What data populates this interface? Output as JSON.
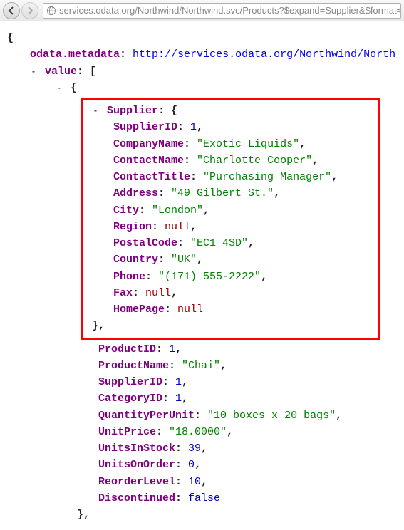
{
  "browser": {
    "url": "services.odata.org/Northwind/Northwind.svc/Products?$expand=Supplier&$format=jso"
  },
  "json": {
    "metadata_key": "odata.metadata",
    "metadata_url": "http://services.odata.org/Northwind/North",
    "value_key": "value",
    "supplier_key": "Supplier",
    "supplier": {
      "SupplierID": "1",
      "CompanyName": "\"Exotic Liquids\"",
      "ContactName": "\"Charlotte Cooper\"",
      "ContactTitle": "\"Purchasing Manager\"",
      "Address": "\"49 Gilbert St.\"",
      "City": "\"London\"",
      "Region": "null",
      "PostalCode": "\"EC1 4SD\"",
      "Country": "\"UK\"",
      "Phone": "\"(171) 555-2222\"",
      "Fax": "null",
      "HomePage": "null"
    },
    "product": {
      "ProductID": "1",
      "ProductName": "\"Chai\"",
      "SupplierID": "1",
      "CategoryID": "1",
      "QuantityPerUnit": "\"10 boxes x 20 bags\"",
      "UnitPrice": "\"18.0000\"",
      "UnitsInStock": "39",
      "UnitsOnOrder": "0",
      "ReorderLevel": "10",
      "Discontinued": "false"
    },
    "keys": {
      "SupplierID": "SupplierID",
      "CompanyName": "CompanyName",
      "ContactName": "ContactName",
      "ContactTitle": "ContactTitle",
      "Address": "Address",
      "City": "City",
      "Region": "Region",
      "PostalCode": "PostalCode",
      "Country": "Country",
      "Phone": "Phone",
      "Fax": "Fax",
      "HomePage": "HomePage",
      "ProductID": "ProductID",
      "ProductName": "ProductName",
      "CategoryID": "CategoryID",
      "QuantityPerUnit": "QuantityPerUnit",
      "UnitPrice": "UnitPrice",
      "UnitsInStock": "UnitsInStock",
      "UnitsOnOrder": "UnitsOnOrder",
      "ReorderLevel": "ReorderLevel",
      "Discontinued": "Discontinued"
    }
  }
}
